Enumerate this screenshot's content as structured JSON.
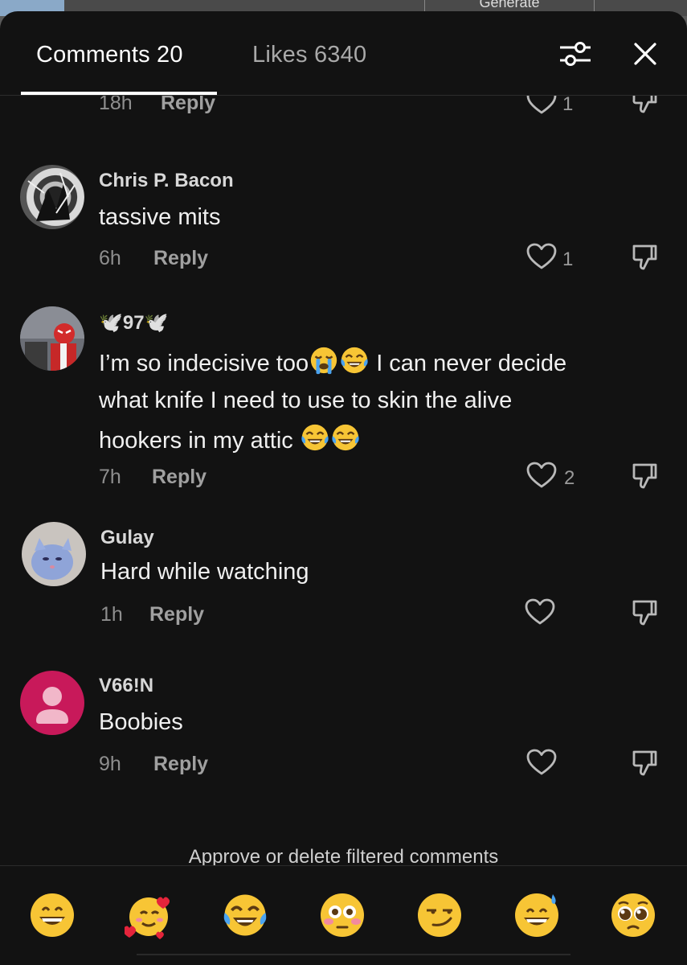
{
  "header": {
    "comments_tab": "Comments 20",
    "likes_tab": "Likes 6340"
  },
  "background": {
    "generate_label": "Generate"
  },
  "partial_comment": {
    "time": "18h",
    "reply": "Reply",
    "likes": "1"
  },
  "comments": [
    {
      "username": "Chris P. Bacon",
      "text": "tassive mits",
      "time": "6h",
      "reply": "Reply",
      "likes": "1"
    },
    {
      "username": "97",
      "line1": "I’m so indecisive too",
      "line1b": "I can never decide",
      "line2": "what knife I need to use to skin the alive",
      "line3": "hookers in my attic",
      "time": "7h",
      "reply": "Reply",
      "likes": "2"
    },
    {
      "username": "Gulay",
      "text": "Hard while watching",
      "time": "1h",
      "reply": "Reply",
      "likes": ""
    },
    {
      "username": "V66!N",
      "text": "Boobies",
      "time": "9h",
      "reply": "Reply",
      "likes": ""
    }
  ],
  "footer": {
    "approve_text": "Approve or delete filtered comments",
    "quick_emojis": [
      "grinning-face",
      "smiling-face-with-hearts",
      "face-with-tears-of-joy",
      "flushed-face",
      "smirking-face",
      "grinning-face-with-sweat",
      "pleading-face"
    ]
  },
  "colors": {
    "sheet_background": "#121212",
    "text_primary": "#ffffff",
    "text_secondary": "#8e8e8e",
    "default_avatar": "#c8195a"
  }
}
